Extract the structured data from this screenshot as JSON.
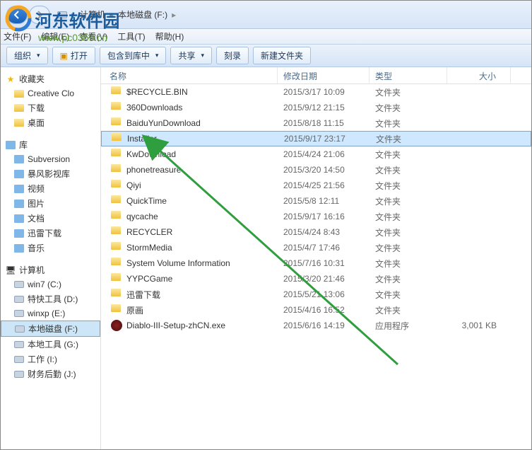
{
  "watermark": {
    "title": "河东软件园",
    "url": "www.pc0359.cn"
  },
  "breadcrumb": {
    "part1": "计算机",
    "part2": "本地磁盘 (F:)"
  },
  "menus": [
    "文件(F)",
    "编辑(E)",
    "查看(V)",
    "工具(T)",
    "帮助(H)"
  ],
  "toolbar": {
    "organize": "组织",
    "open": "打开",
    "include": "包含到库中",
    "share": "共享",
    "burn": "刻录",
    "newfolder": "新建文件夹"
  },
  "sidebar": {
    "favorites": {
      "label": "收藏夹",
      "items": [
        "Creative Clo",
        "下载",
        "桌面"
      ]
    },
    "libraries": {
      "label": "库",
      "items": [
        "Subversion",
        "暴风影视库",
        "视频",
        "图片",
        "文档",
        "迅雷下载",
        "音乐"
      ]
    },
    "computer": {
      "label": "计算机",
      "items": [
        "win7 (C:)",
        "特快工具 (D:)",
        "winxp (E:)",
        "本地磁盘 (F:)",
        "本地工具 (G:)",
        "工作 (I:)",
        "财务后勤 (J:)"
      ]
    }
  },
  "columns": {
    "name": "名称",
    "date": "修改日期",
    "type": "类型",
    "size": "大小"
  },
  "files": [
    {
      "name": "$RECYCLE.BIN",
      "date": "2015/3/17 10:09",
      "type": "文件夹",
      "size": "",
      "icon": "folder"
    },
    {
      "name": "360Downloads",
      "date": "2015/9/12 21:15",
      "type": "文件夹",
      "size": "",
      "icon": "folder"
    },
    {
      "name": "BaiduYunDownload",
      "date": "2015/8/18 11:15",
      "type": "文件夹",
      "size": "",
      "icon": "folder"
    },
    {
      "name": "Installer",
      "date": "2015/9/17 23:17",
      "type": "文件夹",
      "size": "",
      "icon": "folder",
      "selected": true
    },
    {
      "name": "KwDownload",
      "date": "2015/4/24 21:06",
      "type": "文件夹",
      "size": "",
      "icon": "folder"
    },
    {
      "name": "phonetreasure",
      "date": "2015/3/20 14:50",
      "type": "文件夹",
      "size": "",
      "icon": "folder"
    },
    {
      "name": "Qiyi",
      "date": "2015/4/25 21:56",
      "type": "文件夹",
      "size": "",
      "icon": "folder"
    },
    {
      "name": "QuickTime",
      "date": "2015/5/8 12:11",
      "type": "文件夹",
      "size": "",
      "icon": "folder"
    },
    {
      "name": "qycache",
      "date": "2015/9/17 16:16",
      "type": "文件夹",
      "size": "",
      "icon": "folder"
    },
    {
      "name": "RECYCLER",
      "date": "2015/4/24 8:43",
      "type": "文件夹",
      "size": "",
      "icon": "folder"
    },
    {
      "name": "StormMedia",
      "date": "2015/4/7 17:46",
      "type": "文件夹",
      "size": "",
      "icon": "folder"
    },
    {
      "name": "System Volume Information",
      "date": "2015/7/16 10:31",
      "type": "文件夹",
      "size": "",
      "icon": "folder"
    },
    {
      "name": "YYPCGame",
      "date": "2015/3/20 21:46",
      "type": "文件夹",
      "size": "",
      "icon": "folder"
    },
    {
      "name": "迅雷下载",
      "date": "2015/5/21 13:06",
      "type": "文件夹",
      "size": "",
      "icon": "folder"
    },
    {
      "name": "原画",
      "date": "2015/4/16 16:52",
      "type": "文件夹",
      "size": "",
      "icon": "folder"
    },
    {
      "name": "Diablo-III-Setup-zhCN.exe",
      "date": "2015/6/16 14:19",
      "type": "应用程序",
      "size": "3,001 KB",
      "icon": "exe"
    }
  ],
  "selected_drive_index": 3
}
